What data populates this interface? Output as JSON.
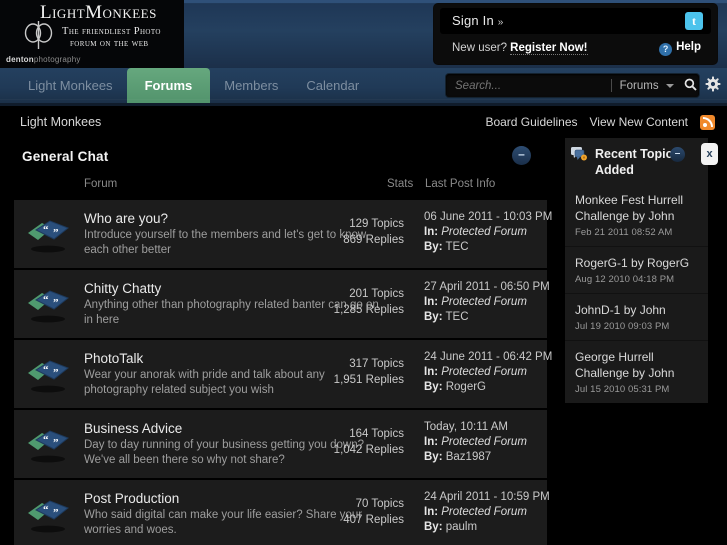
{
  "header": {
    "logo_title": "LightMonkees",
    "logo_sub1": "The friendliest Photo",
    "logo_sub2": "forum on the web",
    "credit_bold": "denton",
    "credit_rest": "photography",
    "signin_label": "Sign In",
    "signin_chevron": "»",
    "twitter_icon": "t",
    "new_user_prefix": "New user?",
    "register_label": "Register Now!",
    "help_label": "Help",
    "help_icon_glyph": "?"
  },
  "nav": {
    "items": [
      {
        "label": "Light Monkees",
        "active": false
      },
      {
        "label": "Forums",
        "active": true
      },
      {
        "label": "Members",
        "active": false
      },
      {
        "label": "Calendar",
        "active": false
      }
    ],
    "search_placeholder": "Search...",
    "search_value": "",
    "search_scope": "Forums",
    "search_icon": "search-icon",
    "gear_icon": "gear-icon"
  },
  "breadcrumb": {
    "current": "Light Monkees",
    "links": [
      "Board Guidelines",
      "View New Content"
    ],
    "rss_icon": "rss-icon"
  },
  "category": {
    "title": "General Chat",
    "collapse_glyph": "–",
    "columns": {
      "forum": "Forum",
      "stats": "Stats",
      "last_post": "Last Post Info"
    }
  },
  "forums": [
    {
      "title": "Who are you?",
      "desc": "Introduce yourself to the members and let's get to know each other better",
      "topics": "129 Topics",
      "replies": "869 Replies",
      "last_date": "06 June 2011 - 10:03 PM",
      "in_label": "In:",
      "in_value": "Protected Forum",
      "by_label": "By:",
      "by_value": "TEC"
    },
    {
      "title": "Chitty Chatty",
      "desc": "Anything other than photography related banter can go on in here",
      "topics": "201 Topics",
      "replies": "1,285 Replies",
      "last_date": "27 April 2011 - 06:50 PM",
      "in_label": "In:",
      "in_value": "Protected Forum",
      "by_label": "By:",
      "by_value": "TEC"
    },
    {
      "title": "PhotoTalk",
      "desc": "Wear your anorak with pride and talk about any photography related subject you wish",
      "topics": "317 Topics",
      "replies": "1,951 Replies",
      "last_date": "24 June 2011 - 06:42 PM",
      "in_label": "In:",
      "in_value": "Protected Forum",
      "by_label": "By:",
      "by_value": "RogerG"
    },
    {
      "title": "Business Advice",
      "desc": "Day to day running of your business getting you down? We've all been there so why not share?",
      "topics": "164 Topics",
      "replies": "1,042 Replies",
      "last_date": "Today, 10:11 AM",
      "in_label": "In:",
      "in_value": "Protected Forum",
      "by_label": "By:",
      "by_value": "Baz1987"
    },
    {
      "title": "Post Production",
      "desc": "Who said digital can make your life easier? Share your worries and woes.",
      "topics": "70 Topics",
      "replies": "407 Replies",
      "last_date": "24 April 2011 - 10:59 PM",
      "in_label": "In:",
      "in_value": "Protected Forum",
      "by_label": "By:",
      "by_value": "paulm"
    }
  ],
  "sidebar": {
    "title": "Recent Topics Added",
    "minimize_glyph": "–",
    "close_glyph": "x",
    "items": [
      {
        "title": "Monkee Fest Hurrell Challenge by John",
        "date": "Feb 21 2011 08:52 AM"
      },
      {
        "title": "RogerG-1 by RogerG",
        "date": "Aug 12 2010 04:18 PM"
      },
      {
        "title": "JohnD-1 by John",
        "date": "Jul 19 2010 09:03 PM"
      },
      {
        "title": "George Hurrell Challenge by John",
        "date": "Jul 15 2010 05:31 PM"
      }
    ]
  },
  "colors": {
    "nav_active": "#5a9a72",
    "header_blue": "#24405f",
    "row_bg": "#1c1c1c",
    "rss_orange": "#f0892b",
    "twitter_blue": "#4cc3ec"
  }
}
